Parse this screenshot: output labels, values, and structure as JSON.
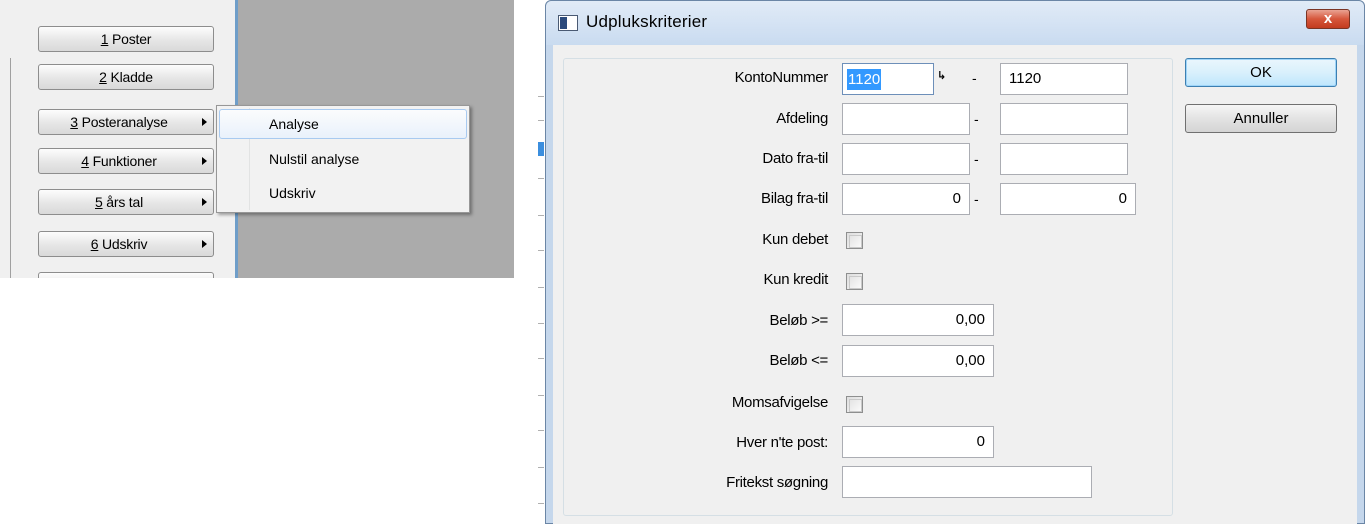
{
  "side_menu": {
    "buttons": [
      {
        "accel": "1",
        "label": " Poster",
        "submenu": false
      },
      {
        "accel": "2",
        "label": " Kladde",
        "submenu": false
      },
      {
        "accel": "3",
        "label": " Posteranalyse",
        "submenu": true
      },
      {
        "accel": "4",
        "label": " Funktioner",
        "submenu": true
      },
      {
        "accel": "5",
        "label": " års tal",
        "submenu": true
      },
      {
        "accel": "6",
        "label": " Udskriv",
        "submenu": true
      }
    ]
  },
  "submenu": {
    "items": [
      "Analyse",
      "Nulstil analyse",
      "Udskriv"
    ]
  },
  "dialog": {
    "title": "Udplukskriterier",
    "close_glyph": "x",
    "ok_label": "OK",
    "cancel_label": "Annuller",
    "dash": "-",
    "fields": {
      "kontonummer": {
        "label": "KontoNummer",
        "from": "1120",
        "to": "1120"
      },
      "afdeling": {
        "label": "Afdeling",
        "from": "",
        "to": ""
      },
      "dato": {
        "label": "Dato  fra-til",
        "from": "",
        "to": ""
      },
      "bilag": {
        "label": "Bilag fra-til",
        "from": "0",
        "to": "0"
      },
      "kun_debet": {
        "label": "Kun debet",
        "checked": false
      },
      "kun_kredit": {
        "label": "Kun kredit",
        "checked": false
      },
      "beloeb_min": {
        "label": "Beløb >=",
        "value": "0,00"
      },
      "beloeb_max": {
        "label": "Beløb <=",
        "value": "0,00"
      },
      "momsafvigelse": {
        "label": "Momsafvigelse",
        "checked": false
      },
      "hver_nte": {
        "label": "Hver n'te post:",
        "value": "0"
      },
      "fritekst": {
        "label": "Fritekst søgning",
        "value": ""
      }
    }
  }
}
